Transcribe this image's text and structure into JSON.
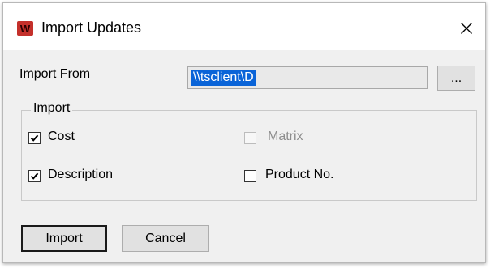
{
  "window": {
    "title": "Import Updates",
    "close_glyph": "✕",
    "app_icon": "app-logo-icon",
    "app_icon_letter": "W"
  },
  "import_from": {
    "label": "Import From",
    "value": "\\\\tsclient\\D",
    "browse_label": "..."
  },
  "import_group": {
    "legend": "Import",
    "options": [
      {
        "label": "Cost",
        "checked": true,
        "enabled": true
      },
      {
        "label": "Matrix",
        "checked": false,
        "enabled": false
      },
      {
        "label": "Description",
        "checked": true,
        "enabled": true
      },
      {
        "label": "Product No.",
        "checked": false,
        "enabled": true
      }
    ]
  },
  "buttons": {
    "import_label": "Import",
    "cancel_label": "Cancel"
  },
  "colors": {
    "selection": "#0a64d8",
    "dialog_bg": "#f0f0f0",
    "app_icon": "#c4302b"
  }
}
